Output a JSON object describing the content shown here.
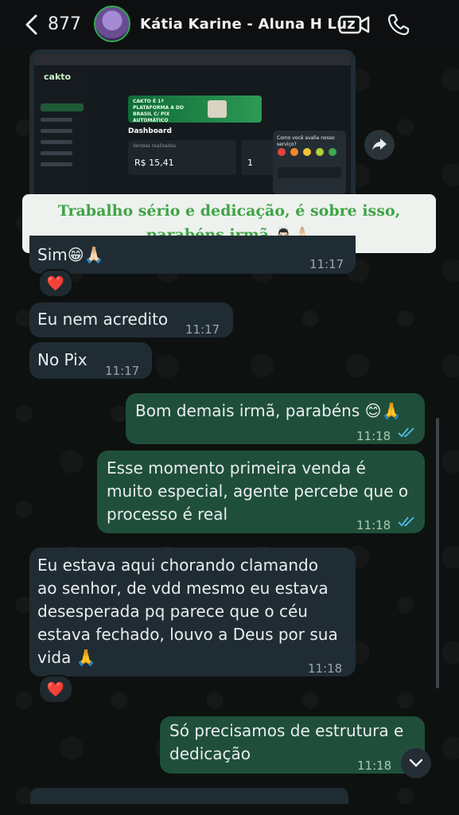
{
  "header": {
    "back_count": "877",
    "contact_name": "Kátia Karine - Aluna H Luz"
  },
  "media": {
    "app_logo": "cakto",
    "banner": "CAKTO É 1ª PLATAFORMA A DO BRASIL C/ PIX AUTOMÁTICO",
    "dashboard_title": "Dashboard",
    "sales_label": "Vendas realizadas",
    "sales_value": "R$ 15,41",
    "orders_value": "1",
    "survey_text": "Como você avalia nosso serviço?",
    "caption_line1": "Trabalho sério e dedicação, é sobre isso,",
    "caption_line2": "parabéns irmã 🙇🏻‍♂️🙏🏻"
  },
  "messages": [
    {
      "dir": "in",
      "text": "Sim😁🙏🏻",
      "time": "11:17",
      "reaction": "❤️"
    },
    {
      "dir": "in",
      "text": "Eu nem acredito",
      "time": "11:17"
    },
    {
      "dir": "in",
      "text": "No Pix",
      "time": "11:17"
    },
    {
      "dir": "out",
      "text": "Bom demais irmã, parabéns 😊🙏",
      "time": "11:18",
      "status": "read"
    },
    {
      "dir": "out",
      "lines": [
        "Esse momento primeira venda é",
        "muito especial, agente percebe que o",
        "processo é real"
      ],
      "time": "11:18",
      "status": "read"
    },
    {
      "dir": "in",
      "lines": [
        "Eu estava aqui chorando clamando",
        "ao senhor, de vdd mesmo eu estava",
        "desesperada pq parece que o céu",
        "estava fechado, louvo a Deus por sua",
        "vida 🙏"
      ],
      "time": "11:18",
      "reaction": "❤️"
    },
    {
      "dir": "out",
      "lines": [
        "Só precisamos de estrutura e",
        "dedicação"
      ],
      "time": "11:18"
    }
  ],
  "icons": {
    "back": "chevron-left-icon",
    "video": "video-call-icon",
    "phone": "phone-icon",
    "forward": "forward-icon",
    "scroll_down": "chevron-down-icon"
  },
  "colors": {
    "incoming": "#202c33",
    "outgoing": "#1f4f3a",
    "read_ticks": "#53bdeb",
    "caption_text": "#3fa446"
  }
}
